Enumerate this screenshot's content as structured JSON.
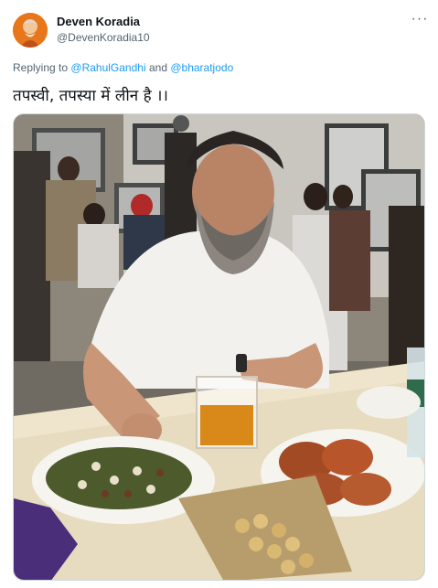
{
  "tweet": {
    "display_name": "Deven Koradia",
    "handle": "@DevenKoradia10",
    "replying_prefix": "Replying to",
    "replying_to": [
      "@RahulGandhi",
      "@bharatjodo"
    ],
    "replying_joiner": "and",
    "text": "तपस्वी, तपस्या में लीन है ।।",
    "more_icon": "more-options-icon"
  },
  "colors": {
    "link": "#1d9bf0",
    "secondary_text": "#536471",
    "primary_text": "#0f1419"
  }
}
